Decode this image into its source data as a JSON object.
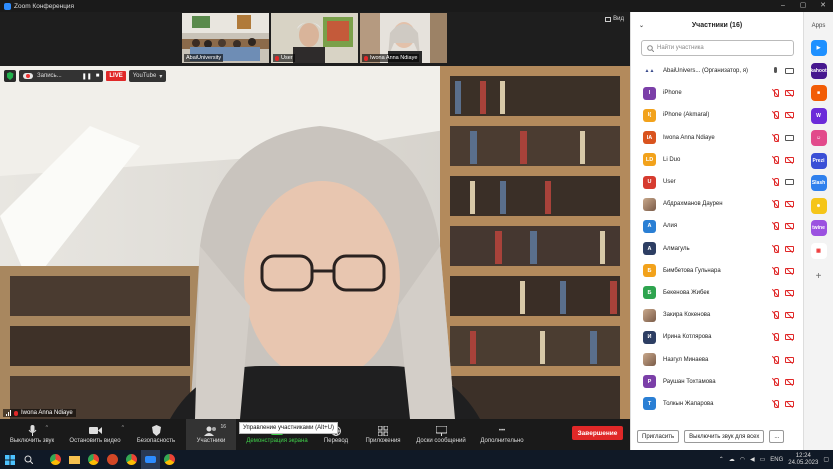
{
  "window": {
    "title": "Zoom Конференция"
  },
  "stage": {
    "view_label": "Вид",
    "thumbnails": [
      {
        "name": "AbaiUniversity",
        "muted": false
      },
      {
        "name": "User",
        "muted": true
      },
      {
        "name": "Iwona Anna Ndiaye",
        "muted": true
      }
    ],
    "recording": {
      "label": "Запись...",
      "pause": "❚❚",
      "stop": "■",
      "live": "LIVE",
      "stream": "YouTube"
    },
    "active_speaker": "Iwona Anna Ndiaye"
  },
  "toolbar": {
    "mute": "Выключить звук",
    "video": "Остановить видео",
    "security": "Безопасность",
    "participants": "Участники",
    "participants_count": "16",
    "share": "Демонстрация экрана",
    "translate": "Перевод",
    "apps": "Приложения",
    "whiteboards": "Доски сообщений",
    "more": "Дополнительно",
    "end": "Завершение",
    "tooltip": "Управление участниками (Alt+U)"
  },
  "participants_panel": {
    "title": "Участники (16)",
    "search_placeholder": "Найти участника",
    "invite": "Пригласить",
    "mute_all": "Выключить звук для всех",
    "more": "...",
    "items": [
      {
        "name": "AbaiUnivers...  (Организатор, я)",
        "initials": "",
        "color": "#ffffff",
        "kind": "logo",
        "mic": "on",
        "cam": "on"
      },
      {
        "name": "iPhone",
        "initials": "I",
        "color": "#7b3fa8",
        "kind": "letter",
        "mic": "off",
        "cam": "off"
      },
      {
        "name": "iPhone (Akmaral)",
        "initials": "I(",
        "color": "#f2a21b",
        "kind": "letter",
        "mic": "off",
        "cam": "off"
      },
      {
        "name": "Iwona Anna Ndiaye",
        "initials": "IA",
        "color": "#d9531e",
        "kind": "letter",
        "mic": "off",
        "cam": "on"
      },
      {
        "name": "Li Duo",
        "initials": "LD",
        "color": "#f2a21b",
        "kind": "letter",
        "mic": "off",
        "cam": "off"
      },
      {
        "name": "User",
        "initials": "U",
        "color": "#d63b2f",
        "kind": "letter",
        "mic": "off",
        "cam": "on"
      },
      {
        "name": "Абдрахманов Даурен",
        "initials": "",
        "color": "#9aa7b5",
        "kind": "photo",
        "mic": "off",
        "cam": "off"
      },
      {
        "name": "Алия",
        "initials": "А",
        "color": "#2a7fd4",
        "kind": "letter",
        "mic": "off",
        "cam": "off"
      },
      {
        "name": "Алмагуль",
        "initials": "А",
        "color": "#2d3e63",
        "kind": "letter",
        "mic": "off",
        "cam": "off"
      },
      {
        "name": "Бимбетова Гульнара",
        "initials": "Б",
        "color": "#f2a21b",
        "kind": "letter",
        "mic": "off",
        "cam": "off"
      },
      {
        "name": "Бекенова Жибек",
        "initials": "Б",
        "color": "#2ea44f",
        "kind": "letter",
        "mic": "off",
        "cam": "off"
      },
      {
        "name": "Закира Кокенова",
        "initials": "",
        "color": "#b38a74",
        "kind": "photo",
        "mic": "off",
        "cam": "off"
      },
      {
        "name": "Ирина Котлярова",
        "initials": "И",
        "color": "#2d3e63",
        "kind": "letter",
        "mic": "off",
        "cam": "off"
      },
      {
        "name": "Назгул Минаева",
        "initials": "",
        "color": "#c9a98c",
        "kind": "photo",
        "mic": "off",
        "cam": "off"
      },
      {
        "name": "Раушан Тохтамова",
        "initials": "Р",
        "color": "#7b3fa8",
        "kind": "letter",
        "mic": "off",
        "cam": "off"
      },
      {
        "name": "Толкын Жапарова",
        "initials": "Т",
        "color": "#2a7fd4",
        "kind": "letter",
        "mic": "off",
        "cam": "off"
      }
    ]
  },
  "apps_sidebar": {
    "title": "Apps",
    "items": [
      {
        "label": "▶",
        "color": "#1e90ff"
      },
      {
        "label": "kahoot",
        "color": "#46178f"
      },
      {
        "label": "■",
        "color": "#f25c05"
      },
      {
        "label": "W",
        "color": "#6c2bd9"
      },
      {
        "label": "☺",
        "color": "#e24a8b"
      },
      {
        "label": "Prezi",
        "color": "#3a4fd6"
      },
      {
        "label": "Slash",
        "color": "#2f80ed"
      },
      {
        "label": "☻",
        "color": "#f5c518"
      },
      {
        "label": "twine",
        "color": "#9b51e0"
      },
      {
        "label": "▦",
        "color": "#ffffff"
      }
    ],
    "add": "+"
  },
  "taskbar": {
    "lang": "ENG",
    "time": "12:24",
    "date": "24.05.2023"
  }
}
